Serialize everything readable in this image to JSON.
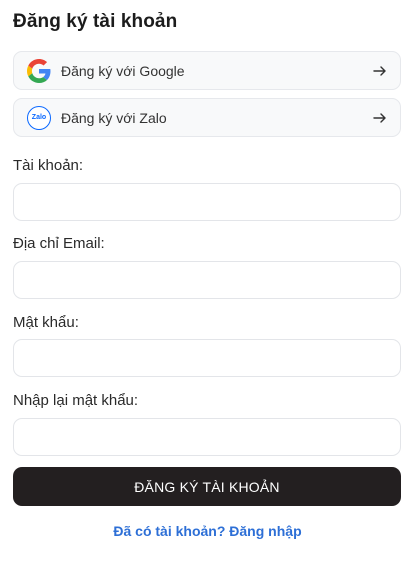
{
  "header": {
    "title": "Đăng ký tài khoản"
  },
  "social": {
    "google": {
      "label": "Đăng ký với Google",
      "icon": "google-logo-icon"
    },
    "zalo": {
      "label": "Đăng ký với Zalo",
      "icon": "zalo-logo-icon",
      "badge_text": "Zalo"
    },
    "arrow_icon": "arrow-right-icon"
  },
  "form": {
    "username": {
      "label": "Tài khoản:",
      "value": "",
      "placeholder": ""
    },
    "email": {
      "label": "Địa chỉ Email:",
      "value": "",
      "placeholder": ""
    },
    "password": {
      "label": "Mật khẩu:",
      "value": "",
      "placeholder": ""
    },
    "confirm_password": {
      "label": "Nhập lại mật khẩu:",
      "value": "",
      "placeholder": ""
    },
    "submit_label": "ĐĂNG KÝ TÀI KHOẢN"
  },
  "footer": {
    "login_link": "Đã có tài khoản? Đăng nhập"
  },
  "colors": {
    "primary_button": "#231f20",
    "link": "#2d6fd6",
    "zalo_blue": "#0a68ff"
  }
}
